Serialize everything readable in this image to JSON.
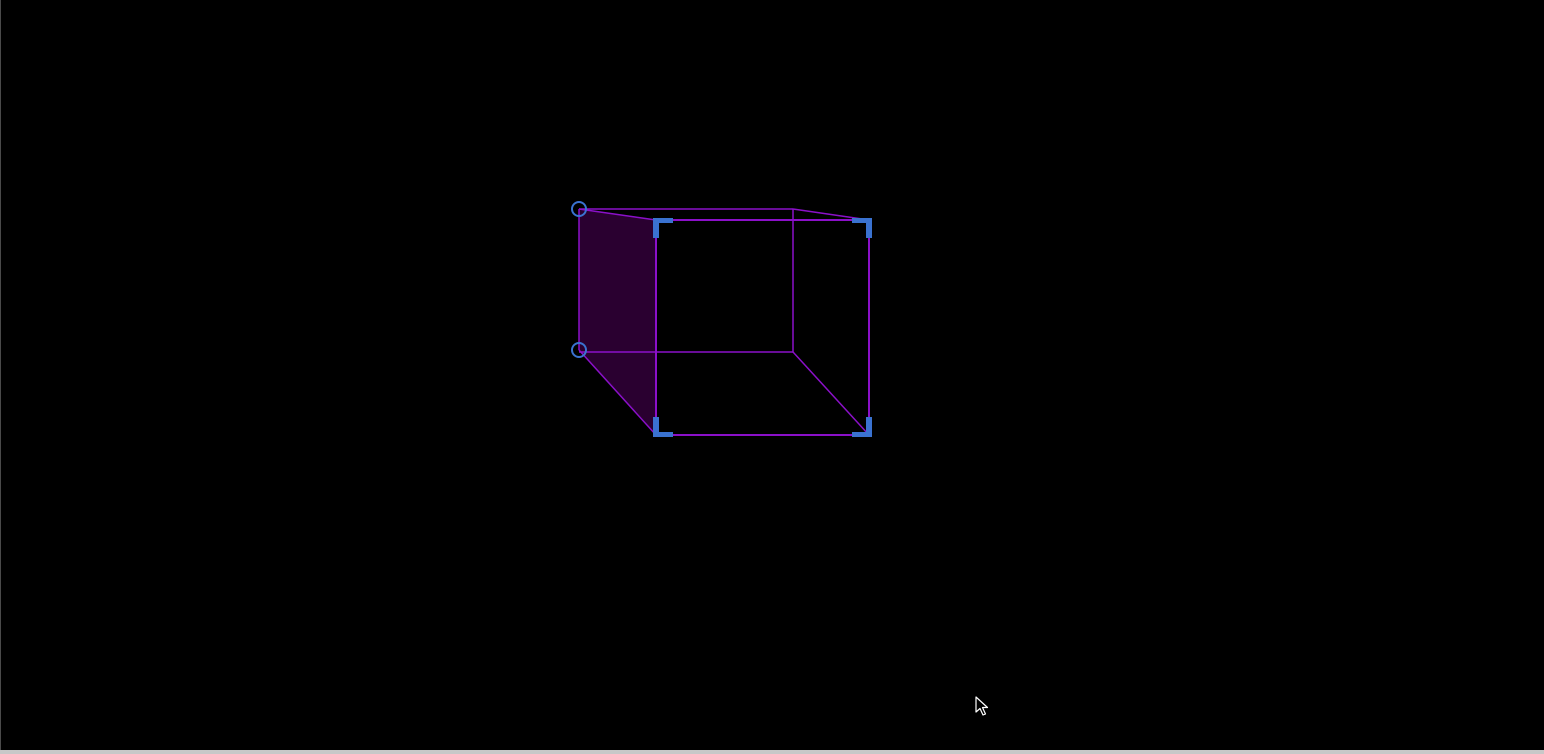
{
  "app": {
    "background": "#000000",
    "bottom_bar_color": "#c8c8c8"
  },
  "selection": {
    "shape": "cuboid",
    "stroke_color": "#8b10c9",
    "side_face_fill": "#2a0030",
    "handle_color": "#3a72d0",
    "corner_handle_icon": "corner-bracket",
    "vertex_handle_icon": "circle-ring",
    "selected": true
  },
  "cursor": {
    "icon": "arrow-pointer"
  }
}
